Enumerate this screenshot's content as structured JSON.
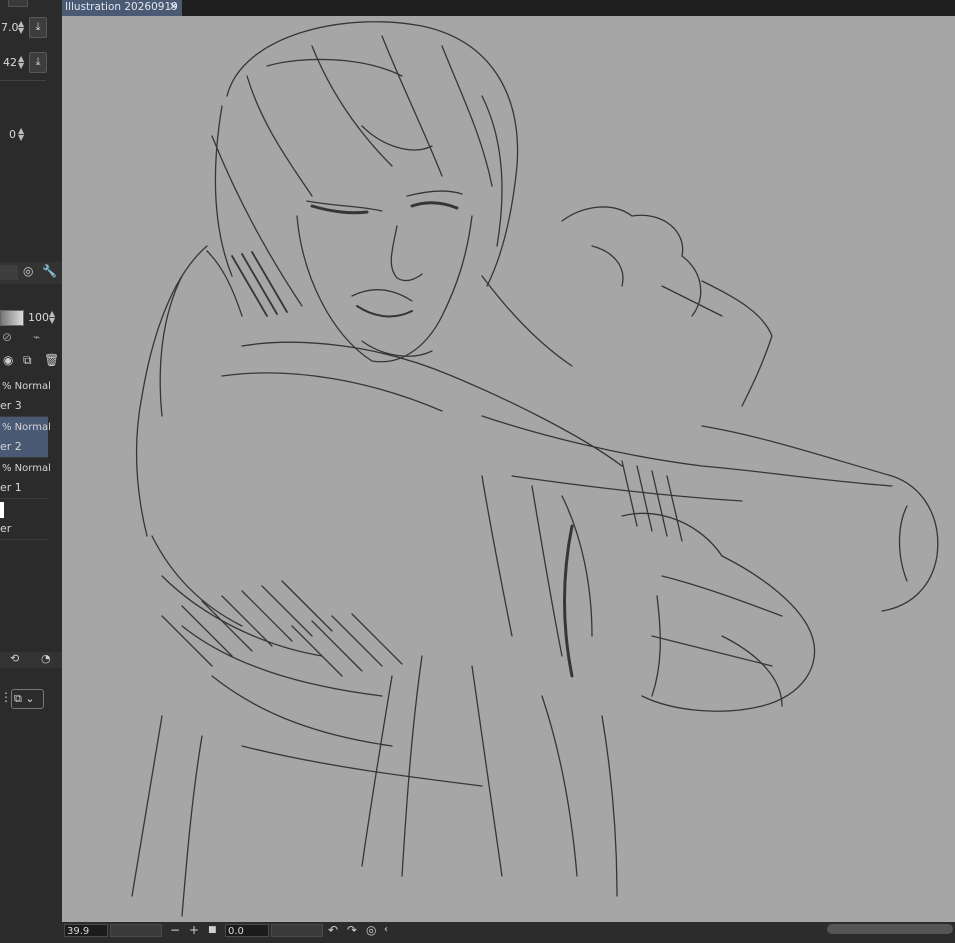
{
  "tab": {
    "title": "Illustration 20260919",
    "close_glyph": "✕"
  },
  "tool_props": {
    "brush_size": "7.0",
    "opacity": "42",
    "stabilization": "0"
  },
  "layers": {
    "opacity": "100",
    "items": [
      {
        "mode": "% Normal",
        "name": "er 3",
        "selected": false
      },
      {
        "mode": "% Normal",
        "name": "er 2",
        "selected": true
      },
      {
        "mode": "% Normal",
        "name": "er 1",
        "selected": false
      },
      {
        "mode": "",
        "name": "er",
        "selected": false
      }
    ]
  },
  "status": {
    "zoom": "39.9",
    "angle": "0.0"
  },
  "colors": {
    "canvas": "#a6a6a6",
    "panel": "#2b2b2b",
    "selection": "#4a5a75"
  }
}
